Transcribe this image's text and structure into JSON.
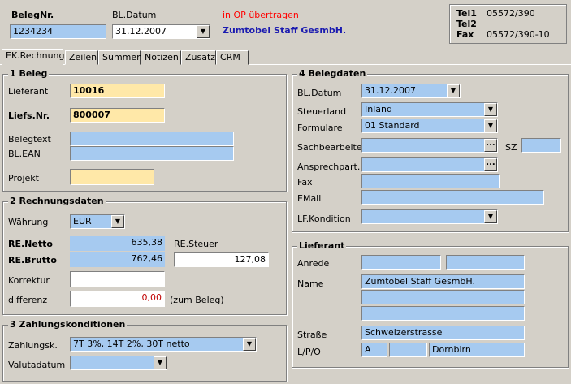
{
  "header": {
    "belegnr_label": "BelegNr.",
    "belegnr_value": "1234234",
    "bldatum_label": "BL.Datum",
    "bldatum_value": "31.12.2007",
    "op_notice": "in OP übertragen",
    "company": "Zumtobel Staff GesmbH."
  },
  "contact": {
    "tel1_label": "Tel1",
    "tel1_value": "05572/390",
    "tel2_label": "Tel2",
    "tel2_value": "",
    "fax_label": "Fax",
    "fax_value": "05572/390-10"
  },
  "tabs": [
    "EK.Rechnung",
    "Zeilen",
    "Summen",
    "Notizen",
    "Zusatz",
    "CRM"
  ],
  "beleg": {
    "title": "1 Beleg",
    "lieferant_label": "Lieferant",
    "lieferant_value": "10016",
    "liefsnr_label": "Liefs.Nr.",
    "liefsnr_value": "800007",
    "belegtext_label": "Belegtext",
    "belegtext_value": "",
    "blean_label": "BL.EAN",
    "blean_value": "",
    "projekt_label": "Projekt",
    "projekt_value": ""
  },
  "rechnung": {
    "title": "2 Rechnungsdaten",
    "waehrung_label": "Währung",
    "waehrung_value": "EUR",
    "netto_label": "RE.Netto",
    "netto_value": "635,38",
    "steuer_label": "RE.Steuer",
    "steuer_value": "127,08",
    "brutto_label": "RE.Brutto",
    "brutto_value": "762,46",
    "korrektur_label": "Korrektur",
    "korrektur_value": "",
    "differenz_label": "differenz",
    "differenz_value": "0,00",
    "zum_beleg": "(zum Beleg)"
  },
  "zahlung": {
    "title": "3 Zahlungskonditionen",
    "zahlungsk_label": "Zahlungsk.",
    "zahlungsk_value": "7T 3%, 14T 2%, 30T netto",
    "valutadatum_label": "Valutadatum",
    "valutadatum_value": ""
  },
  "belegdaten": {
    "title": "4 Belegdaten",
    "bldatum_label": "BL.Datum",
    "bldatum_value": "31.12.2007",
    "steuerland_label": "Steuerland",
    "steuerland_value": "Inland",
    "formulare_label": "Formulare",
    "formulare_value": "01 Standard",
    "sachbearbeiter_label": "Sachbearbeiter",
    "sachbearbeiter_value": "",
    "sz_label": "SZ",
    "sz_value": "",
    "ansprech_label": "Ansprechpart.",
    "ansprech_value": "",
    "fax_label": "Fax",
    "fax_value": "",
    "email_label": "EMail",
    "email_value": "",
    "lfkondition_label": "LF.Kondition",
    "lfkondition_value": ""
  },
  "lieferant": {
    "title": "Lieferant",
    "anrede_label": "Anrede",
    "name_label": "Name",
    "name_value": "Zumtobel Staff GesmbH.",
    "strasse_label": "Straße",
    "strasse_value": "Schweizerstrasse",
    "lpo_label": "L/P/O",
    "land_value": "A",
    "plz_value": "",
    "ort_value": "Dornbirn"
  },
  "icons": {
    "dropdown": "▼",
    "ellipsis": "..."
  }
}
